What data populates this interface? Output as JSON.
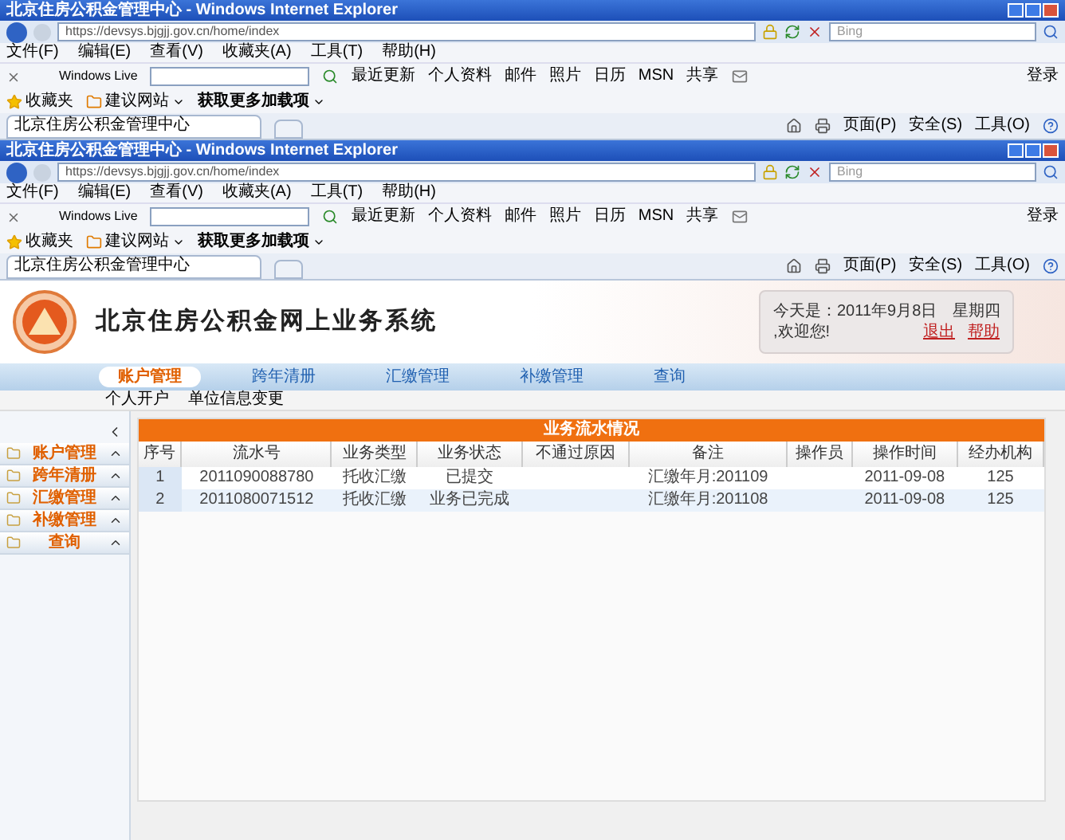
{
  "browser_windows": [
    {
      "title": "北京住房公积金管理中心 - Windows Internet Explorer",
      "url": "https://devsys.bjgjj.gov.cn/home/index",
      "search_placeholder": "Bing",
      "menu": [
        "文件(F)",
        "编辑(E)",
        "查看(V)",
        "收藏夹(A)",
        "工具(T)",
        "帮助(H)"
      ],
      "live_label": "Windows Live",
      "toolbar_links": [
        "最近更新",
        "个人资料",
        "邮件",
        "照片",
        "日历",
        "MSN",
        "共享"
      ],
      "login": "登录",
      "favorites": "收藏夹",
      "suggested_sites": "建议网站",
      "addons": "获取更多加载项",
      "tab_title": "北京住房公积金管理中心",
      "page_menu": "页面(P)",
      "safety_menu": "安全(S)",
      "tools_menu": "工具(O)"
    },
    {
      "title": "北京住房公积金管理中心 - Windows Internet Explorer",
      "url": "https://devsys.bjgjj.gov.cn/home/index",
      "search_placeholder": "Bing",
      "menu": [
        "文件(F)",
        "编辑(E)",
        "查看(V)",
        "收藏夹(A)",
        "工具(T)",
        "帮助(H)"
      ],
      "live_label": "Windows Live",
      "toolbar_links": [
        "最近更新",
        "个人资料",
        "邮件",
        "照片",
        "日历",
        "MSN",
        "共享"
      ],
      "login": "登录",
      "favorites": "收藏夹",
      "suggested_sites": "建议网站",
      "addons": "获取更多加载项",
      "tab_title": "北京住房公积金管理中心",
      "page_menu": "页面(P)",
      "safety_menu": "安全(S)",
      "tools_menu": "工具(O)"
    }
  ],
  "page": {
    "site_title": "北京住房公积金网上业务系统",
    "date_line": "今天是：2011年9月8日　星期四",
    "welcome": ",欢迎您!",
    "logout": "退出",
    "help": "帮助",
    "nav_tabs": [
      {
        "label": "账户管理",
        "selected": true
      },
      {
        "label": "跨年清册",
        "selected": false
      },
      {
        "label": "汇缴管理",
        "selected": false
      },
      {
        "label": "补缴管理",
        "selected": false
      },
      {
        "label": "查询",
        "selected": false
      }
    ],
    "sub_nav": [
      "个人开户",
      "单位信息变更"
    ],
    "sidebar": [
      "账户管理",
      "跨年清册",
      "汇缴管理",
      "补缴管理",
      "查询"
    ],
    "panel_title": "业务流水情况",
    "table": {
      "columns": [
        "序号",
        "流水号",
        "业务类型",
        "业务状态",
        "不通过原因",
        "备注",
        "操作员",
        "操作时间",
        "经办机构"
      ],
      "rows": [
        [
          "1",
          "2011090088780",
          "托收汇缴",
          "已提交",
          "",
          "汇缴年月:201109",
          "",
          "2011-09-08",
          "125"
        ],
        [
          "2",
          "2011080071512",
          "托收汇缴",
          "业务已完成",
          "",
          "汇缴年月:201108",
          "",
          "2011-09-08",
          "125"
        ]
      ]
    }
  }
}
